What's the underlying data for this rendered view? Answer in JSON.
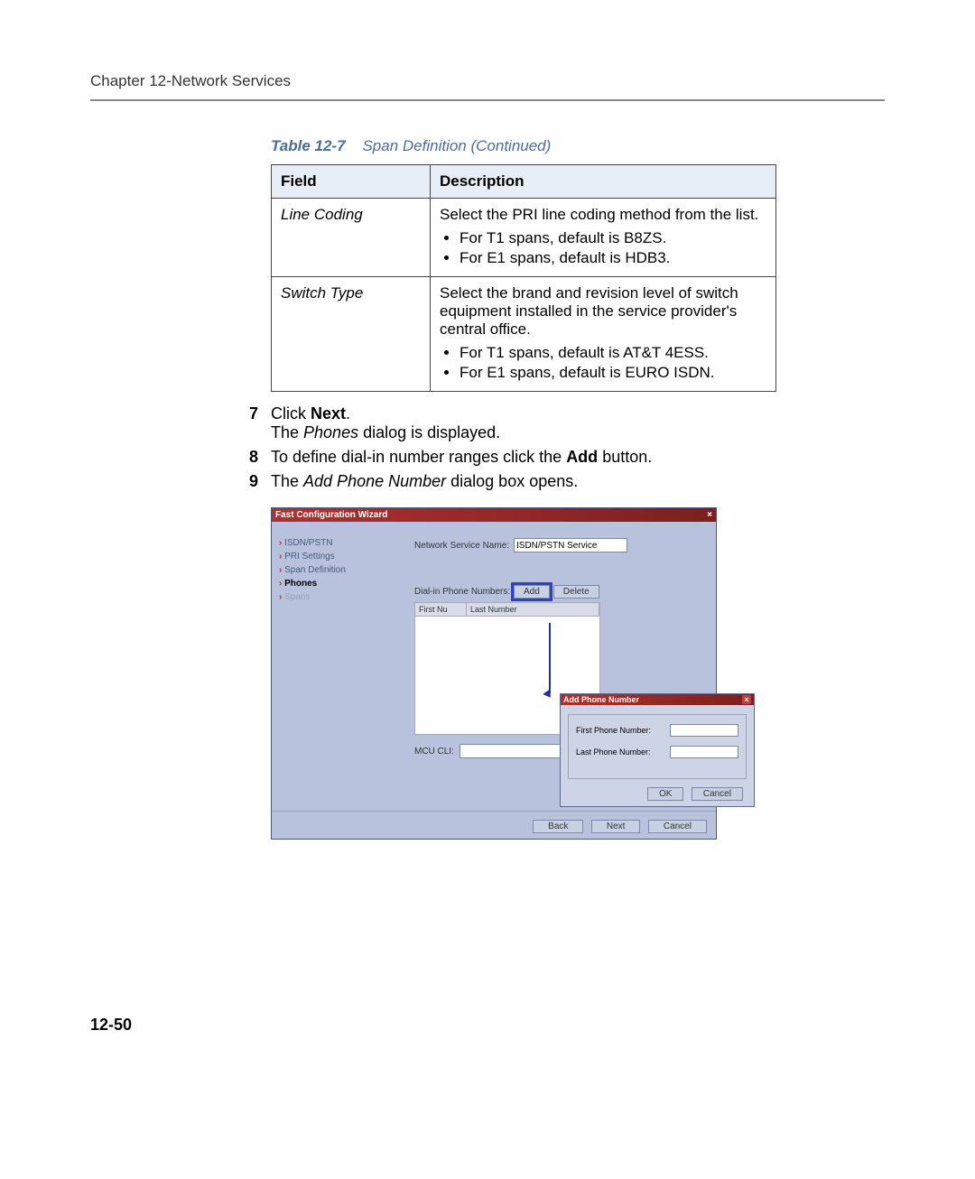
{
  "header": {
    "chapter": "Chapter 12-Network Services"
  },
  "tableCaption": {
    "label": "Table 12-7",
    "text": "Span Definition (Continued)"
  },
  "table": {
    "headers": {
      "field": "Field",
      "description": "Description"
    },
    "rows": [
      {
        "field": "Line Coding",
        "desc": "Select the PRI line coding method from the list.",
        "bullets": [
          "For T1 spans, default is B8ZS.",
          "For E1 spans, default is HDB3."
        ]
      },
      {
        "field": "Switch Type",
        "desc": "Select the brand and revision level of switch equipment installed in the service provider's central office.",
        "bullets": [
          "For T1 spans, default is AT&T 4ESS.",
          "For E1 spans, default is EURO ISDN."
        ]
      }
    ]
  },
  "steps": [
    {
      "num": "7",
      "parts": [
        {
          "t": "Click ",
          "cls": ""
        },
        {
          "t": "Next",
          "cls": "bold"
        },
        {
          "t": ".",
          "cls": ""
        }
      ],
      "sub": [
        {
          "t": "The ",
          "cls": ""
        },
        {
          "t": "Phones",
          "cls": "italic"
        },
        {
          "t": " dialog is displayed.",
          "cls": ""
        }
      ]
    },
    {
      "num": "8",
      "parts": [
        {
          "t": "To define dial-in number ranges click the ",
          "cls": ""
        },
        {
          "t": "Add",
          "cls": "bold"
        },
        {
          "t": " button.",
          "cls": ""
        }
      ]
    },
    {
      "num": "9",
      "parts": [
        {
          "t": "The ",
          "cls": ""
        },
        {
          "t": "Add Phone Number",
          "cls": "italic"
        },
        {
          "t": " dialog box opens.",
          "cls": ""
        }
      ]
    }
  ],
  "wizard": {
    "title": "Fast Configuration Wizard",
    "sideItems": [
      {
        "label": "ISDN/PSTN",
        "state": ""
      },
      {
        "label": "PRI Settings",
        "state": ""
      },
      {
        "label": "Span Definition",
        "state": ""
      },
      {
        "label": "Phones",
        "state": "current"
      },
      {
        "label": "Spans",
        "state": "disabled"
      }
    ],
    "networkServiceLabel": "Network Service Name:",
    "networkServiceValue": "ISDN/PSTN Service",
    "dialInLabel": "Dial-in Phone Numbers:",
    "addBtn": "Add",
    "deleteBtn": "Delete",
    "gridCols": {
      "first": "First Nu",
      "last": "Last Number"
    },
    "mcuLabel": "MCU CLI:",
    "footer": {
      "back": "Back",
      "next": "Next",
      "cancel": "Cancel"
    }
  },
  "addPopup": {
    "title": "Add Phone Number",
    "firstLabel": "First Phone Number:",
    "lastLabel": "Last Phone Number:",
    "ok": "OK",
    "cancel": "Cancel"
  },
  "pageNum": "12-50"
}
